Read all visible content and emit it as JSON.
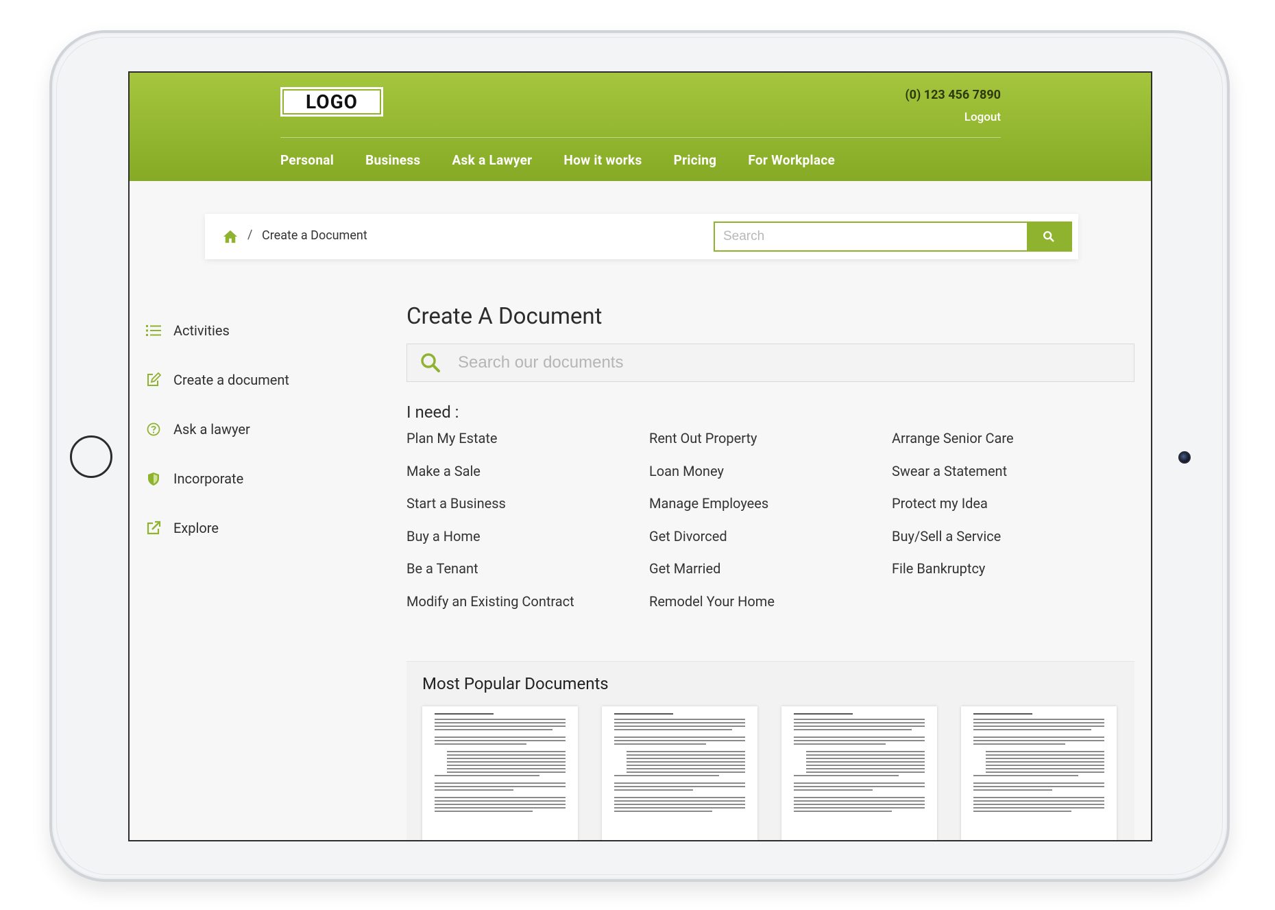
{
  "header": {
    "logo": "LOGO",
    "phone": "(0) 123 456 7890",
    "logout": "Logout",
    "nav": [
      "Personal",
      "Business",
      "Ask a Lawyer",
      "How it works",
      "Pricing",
      "For Workplace"
    ]
  },
  "breadcrumb": {
    "separator": "/",
    "current": "Create a Document"
  },
  "search": {
    "placeholder": "Search"
  },
  "sidebar": {
    "items": [
      {
        "label": "Activities",
        "icon": "list-icon"
      },
      {
        "label": "Create a document",
        "icon": "edit-icon"
      },
      {
        "label": "Ask a lawyer",
        "icon": "question-circle-icon"
      },
      {
        "label": "Incorporate",
        "icon": "shield-icon"
      },
      {
        "label": "Explore",
        "icon": "external-link-icon"
      }
    ]
  },
  "main": {
    "title": "Create A Document",
    "doc_search_placeholder": "Search our documents",
    "need_label": "I need :",
    "needs": [
      "Plan My Estate",
      "Rent Out Property",
      "Arrange Senior Care",
      "Make a Sale",
      "Loan Money",
      "Swear a Statement",
      "Start a Business",
      "Manage Employees",
      "Protect my Idea",
      "Buy a Home",
      "Get Divorced",
      "Buy/Sell a Service",
      "Be a Tenant",
      "Get Married",
      "File Bankruptcy",
      "Modify an Existing Contract",
      "Remodel Your Home",
      ""
    ]
  },
  "popular": {
    "title": "Most Popular Documents",
    "count": 4
  },
  "colors": {
    "brand_green": "#8fb22f",
    "header_top": "#a5c63e",
    "header_bottom": "#86aa25"
  }
}
